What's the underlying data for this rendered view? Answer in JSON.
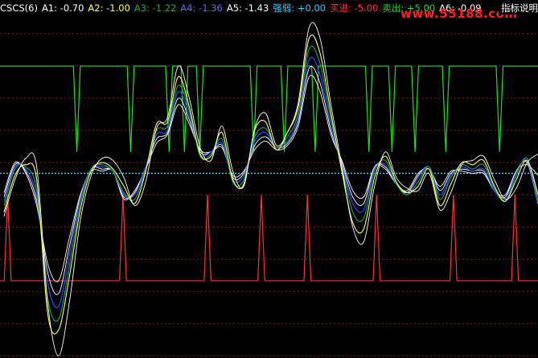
{
  "indicator": {
    "name": "CSCS(6)",
    "labels": [
      {
        "key": "a1",
        "text": "A1: -0.70",
        "color": "#ffffff"
      },
      {
        "key": "a2",
        "text": "A2: -1.00",
        "color": "#ffff66"
      },
      {
        "key": "a3",
        "text": "A3: -1.22",
        "color": "#1aa84a"
      },
      {
        "key": "a4",
        "text": "A4: -1.36",
        "color": "#5a6cff"
      },
      {
        "key": "a5",
        "text": "A5: -1.43",
        "color": "#ffffff"
      },
      {
        "key": "qiangruo",
        "text": "强弱: +0.00",
        "color": "#33ccff"
      },
      {
        "key": "buy",
        "text": "买进: -5.00",
        "color": "#ff3030"
      },
      {
        "key": "sell",
        "text": "卖出: +5.00",
        "color": "#22dd22"
      },
      {
        "key": "a6",
        "text": "A6: -0.09",
        "color": "#ffffff"
      }
    ]
  },
  "watermark": "www.55188.com",
  "help_button": "指标说明",
  "colors": {
    "background": "#000000",
    "grid": "#8b1a1a",
    "a1": "#ffffff",
    "a2": "#ffff66",
    "a3": "#1aa84a",
    "a4": "#3344ff",
    "a5": "#ffffff",
    "a6": "#ffffff",
    "qiangruo": "#33ccff",
    "buy": "#ff3030",
    "sell": "#22dd22"
  },
  "chart_data": {
    "type": "line",
    "ylim": [
      -8.6,
      7.4
    ],
    "grid": true,
    "gridlines": [
      6.5,
      5.0,
      3.5,
      2.0,
      0.5,
      -1.0,
      -2.5,
      -4.0,
      -5.5,
      -7.0,
      -8.5
    ],
    "qiangruo_level": 0.0,
    "buy_level": -5.0,
    "sell_level": 5.0,
    "sell_spike_to": 1.0,
    "buy_spike_to": -1.0,
    "x_count": 35,
    "a1_values": [
      -2.0,
      -0.3,
      0.7,
      0.3,
      -6.0,
      -8.5,
      -6.0,
      -2.2,
      -0.1,
      0.7,
      0.6,
      -0.2,
      -1.5,
      -0.4,
      2.1,
      2.6,
      5.0,
      3.5,
      1.2,
      0.6,
      2.2,
      0.1,
      -0.6,
      2.1,
      2.8,
      1.3,
      1.9,
      3.3,
      6.8,
      6.3,
      3.2,
      0.3,
      -2.5,
      -3.2,
      -0.6,
      1.0,
      -0.2,
      -0.7,
      -0.8,
      0.0,
      -1.7,
      -0.9,
      0.4,
      0.6,
      0.8,
      -0.3,
      -1.2,
      -0.7,
      0.5,
      0.9
    ],
    "a2_values": [
      -1.8,
      -0.1,
      0.4,
      -0.3,
      -6.5,
      -7.3,
      -4.8,
      -1.7,
      0.1,
      0.5,
      0.2,
      -0.6,
      -1.4,
      0.1,
      2.3,
      2.4,
      4.5,
      3.1,
      0.9,
      0.8,
      1.9,
      -0.3,
      -0.5,
      2.0,
      2.4,
      1.1,
      1.9,
      3.1,
      6.3,
      5.6,
      2.8,
      0.1,
      -2.3,
      -2.6,
      -0.2,
      0.8,
      -0.4,
      -0.9,
      -0.6,
      0.2,
      -1.5,
      -0.5,
      0.5,
      0.4,
      0.6,
      -0.6,
      -1.3,
      -0.3,
      0.6,
      -1.0
    ],
    "a3_values": [
      -1.5,
      0.2,
      0.3,
      -0.8,
      -5.8,
      -6.8,
      -4.3,
      -1.4,
      0.2,
      0.4,
      0.1,
      -0.9,
      -1.2,
      0.2,
      2.0,
      2.2,
      4.1,
      2.9,
      0.8,
      0.9,
      1.6,
      -0.4,
      -0.3,
      1.7,
      2.1,
      1.2,
      1.7,
      2.8,
      5.8,
      5.1,
      2.5,
      0.3,
      -1.8,
      -2.1,
      0.1,
      0.6,
      -0.5,
      -1.0,
      -0.4,
      0.3,
      -1.2,
      -0.2,
      0.4,
      0.2,
      0.4,
      -0.7,
      -1.3,
      -0.1,
      0.7,
      -1.22
    ],
    "a4_values": [
      -1.3,
      0.3,
      0.2,
      -1.1,
      -5.1,
      -6.2,
      -3.8,
      -1.2,
      0.2,
      0.3,
      0.1,
      -1.0,
      -1.0,
      0.3,
      1.8,
      2.0,
      3.8,
      2.7,
      0.9,
      1.0,
      1.4,
      -0.3,
      -0.1,
      1.5,
      1.9,
      1.2,
      1.5,
      2.6,
      5.3,
      4.6,
      2.2,
      0.4,
      -1.4,
      -1.7,
      0.2,
      0.4,
      -0.5,
      -1.0,
      -0.2,
      0.3,
      -1.0,
      -0.1,
      0.3,
      0.1,
      0.2,
      -0.8,
      -1.2,
      0.0,
      0.6,
      -1.36
    ],
    "a5_values": [
      -1.1,
      0.4,
      0.1,
      -1.3,
      -4.6,
      -5.6,
      -3.4,
      -1.1,
      0.2,
      0.2,
      0.1,
      -1.1,
      -0.9,
      0.3,
      1.6,
      1.9,
      3.5,
      2.5,
      1.0,
      1.0,
      1.3,
      -0.2,
      0.0,
      1.3,
      1.7,
      1.2,
      1.4,
      2.4,
      4.9,
      4.2,
      2.0,
      0.5,
      -1.1,
      -1.4,
      0.3,
      0.3,
      -0.5,
      -0.9,
      -0.1,
      0.3,
      -0.8,
      0.0,
      0.2,
      0.1,
      0.1,
      -0.8,
      -1.1,
      0.1,
      0.5,
      -1.43
    ],
    "a6_values": [
      -0.9,
      0.5,
      0.0,
      -1.5,
      -4.2,
      -5.0,
      -3.0,
      -1.0,
      0.1,
      0.1,
      0.1,
      -1.2,
      -0.8,
      0.2,
      1.4,
      1.8,
      3.2,
      2.3,
      1.1,
      1.0,
      1.2,
      -0.1,
      0.1,
      1.1,
      1.5,
      1.1,
      1.3,
      2.2,
      4.5,
      3.8,
      1.8,
      0.6,
      -0.8,
      -1.1,
      0.3,
      0.2,
      -0.5,
      -0.8,
      0.0,
      0.2,
      -0.6,
      0.1,
      0.1,
      0.0,
      0.0,
      -0.8,
      -1.0,
      0.1,
      0.4,
      -0.09
    ],
    "sell_signals": [
      10,
      17,
      22,
      24,
      26,
      33,
      37,
      41,
      48,
      51,
      54,
      58,
      65
    ],
    "buy_signals": [
      1,
      14,
      24,
      31,
      36,
      44,
      53,
      60
    ]
  }
}
